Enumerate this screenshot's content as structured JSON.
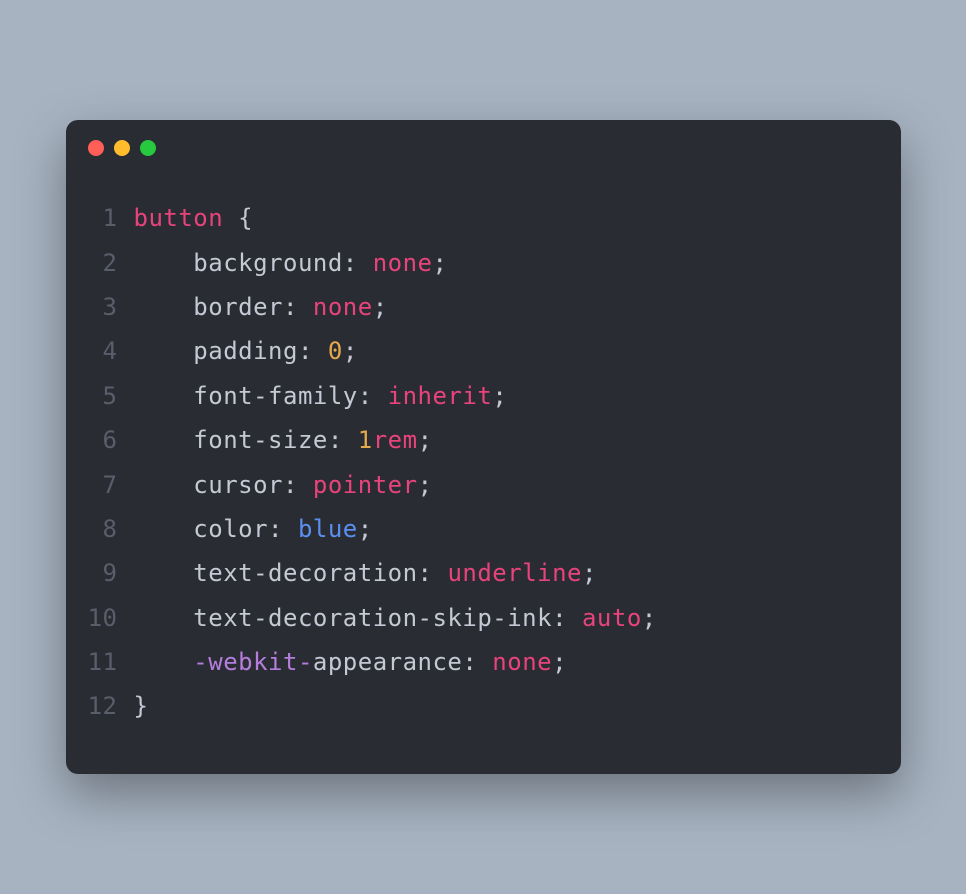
{
  "window": {
    "traffic_lights": {
      "red": "#ff5f56",
      "yellow": "#ffbd2e",
      "green": "#27c93f"
    }
  },
  "code": {
    "language": "css",
    "lines": [
      {
        "number": "1",
        "tokens": [
          {
            "text": "button",
            "type": "selector"
          },
          {
            "text": " ",
            "type": "default"
          },
          {
            "text": "{",
            "type": "brace"
          }
        ]
      },
      {
        "number": "2",
        "tokens": [
          {
            "text": "    ",
            "type": "default"
          },
          {
            "text": "background",
            "type": "property"
          },
          {
            "text": ":",
            "type": "colon"
          },
          {
            "text": " ",
            "type": "default"
          },
          {
            "text": "none",
            "type": "value-keyword"
          },
          {
            "text": ";",
            "type": "semicolon"
          }
        ]
      },
      {
        "number": "3",
        "tokens": [
          {
            "text": "    ",
            "type": "default"
          },
          {
            "text": "border",
            "type": "property"
          },
          {
            "text": ":",
            "type": "colon"
          },
          {
            "text": " ",
            "type": "default"
          },
          {
            "text": "none",
            "type": "value-keyword"
          },
          {
            "text": ";",
            "type": "semicolon"
          }
        ]
      },
      {
        "number": "4",
        "tokens": [
          {
            "text": "    ",
            "type": "default"
          },
          {
            "text": "padding",
            "type": "property"
          },
          {
            "text": ":",
            "type": "colon"
          },
          {
            "text": " ",
            "type": "default"
          },
          {
            "text": "0",
            "type": "number"
          },
          {
            "text": ";",
            "type": "semicolon"
          }
        ]
      },
      {
        "number": "5",
        "tokens": [
          {
            "text": "    ",
            "type": "default"
          },
          {
            "text": "font-family",
            "type": "property"
          },
          {
            "text": ":",
            "type": "colon"
          },
          {
            "text": " ",
            "type": "default"
          },
          {
            "text": "inherit",
            "type": "value-keyword"
          },
          {
            "text": ";",
            "type": "semicolon"
          }
        ]
      },
      {
        "number": "6",
        "tokens": [
          {
            "text": "    ",
            "type": "default"
          },
          {
            "text": "font-size",
            "type": "property"
          },
          {
            "text": ":",
            "type": "colon"
          },
          {
            "text": " ",
            "type": "default"
          },
          {
            "text": "1",
            "type": "number"
          },
          {
            "text": "rem",
            "type": "unit"
          },
          {
            "text": ";",
            "type": "semicolon"
          }
        ]
      },
      {
        "number": "7",
        "tokens": [
          {
            "text": "    ",
            "type": "default"
          },
          {
            "text": "cursor",
            "type": "property"
          },
          {
            "text": ":",
            "type": "colon"
          },
          {
            "text": " ",
            "type": "default"
          },
          {
            "text": "pointer",
            "type": "value-keyword"
          },
          {
            "text": ";",
            "type": "semicolon"
          }
        ]
      },
      {
        "number": "8",
        "tokens": [
          {
            "text": "    ",
            "type": "default"
          },
          {
            "text": "color",
            "type": "property"
          },
          {
            "text": ":",
            "type": "colon"
          },
          {
            "text": " ",
            "type": "default"
          },
          {
            "text": "blue",
            "type": "color-word"
          },
          {
            "text": ";",
            "type": "semicolon"
          }
        ]
      },
      {
        "number": "9",
        "tokens": [
          {
            "text": "    ",
            "type": "default"
          },
          {
            "text": "text-decoration",
            "type": "property"
          },
          {
            "text": ":",
            "type": "colon"
          },
          {
            "text": " ",
            "type": "default"
          },
          {
            "text": "underline",
            "type": "value-keyword"
          },
          {
            "text": ";",
            "type": "semicolon"
          }
        ]
      },
      {
        "number": "10",
        "tokens": [
          {
            "text": "    ",
            "type": "default"
          },
          {
            "text": "text-decoration-skip-ink",
            "type": "property"
          },
          {
            "text": ":",
            "type": "colon"
          },
          {
            "text": " ",
            "type": "default"
          },
          {
            "text": "auto",
            "type": "value-keyword"
          },
          {
            "text": ";",
            "type": "semicolon"
          }
        ]
      },
      {
        "number": "11",
        "tokens": [
          {
            "text": "    ",
            "type": "default"
          },
          {
            "text": "-webkit-",
            "type": "vendor"
          },
          {
            "text": "appearance",
            "type": "property"
          },
          {
            "text": ":",
            "type": "colon"
          },
          {
            "text": " ",
            "type": "default"
          },
          {
            "text": "none",
            "type": "value-keyword"
          },
          {
            "text": ";",
            "type": "semicolon"
          }
        ]
      },
      {
        "number": "12",
        "tokens": [
          {
            "text": "}",
            "type": "brace"
          }
        ]
      }
    ]
  }
}
